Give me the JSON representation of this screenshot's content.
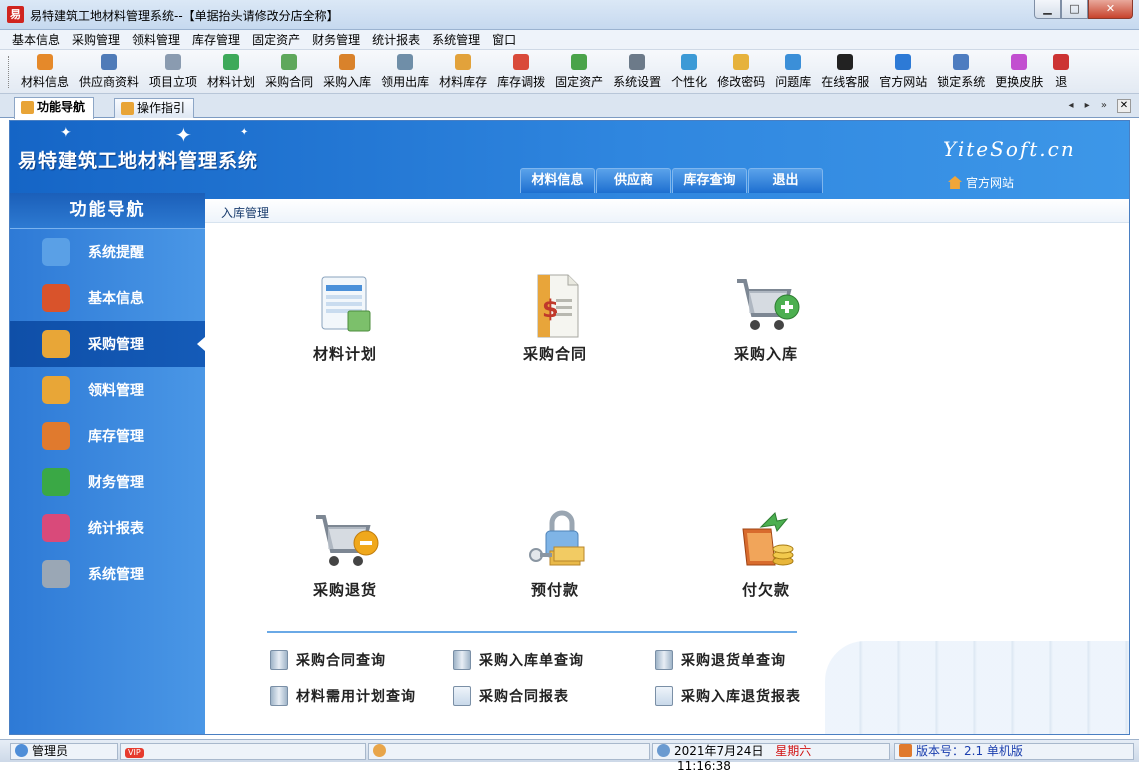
{
  "window": {
    "title": "易特建筑工地材料管理系统--【单据抬头请修改分店全称】",
    "app_icon_text": "易",
    "buttons": {
      "minimize": "▁",
      "maximize": "□",
      "close": "✕"
    }
  },
  "menu": [
    "基本信息",
    "采购管理",
    "领料管理",
    "库存管理",
    "固定资产",
    "财务管理",
    "统计报表",
    "系统管理",
    "窗口"
  ],
  "toolbar": [
    {
      "label": "材料信息",
      "icon": "materials-icon",
      "color": "#e5892a"
    },
    {
      "label": "供应商资料",
      "icon": "supplier-icon",
      "color": "#4f7bb8"
    },
    {
      "label": "项目立项",
      "icon": "project-icon",
      "color": "#8a9bb0"
    },
    {
      "label": "材料计划",
      "icon": "plan-icon",
      "color": "#3da95a"
    },
    {
      "label": "采购合同",
      "icon": "contract-icon",
      "color": "#5fa85c"
    },
    {
      "label": "采购入库",
      "icon": "truck-icon",
      "color": "#d9822b"
    },
    {
      "label": "领用出库",
      "icon": "cart-icon",
      "color": "#6f8ea8"
    },
    {
      "label": "材料库存",
      "icon": "stock-icon",
      "color": "#e2a23b"
    },
    {
      "label": "库存调拨",
      "icon": "transfer-icon",
      "color": "#d94a3a"
    },
    {
      "label": "固定资产",
      "icon": "asset-icon",
      "color": "#4aa34a"
    },
    {
      "label": "系统设置",
      "icon": "settings-icon",
      "color": "#6c7a89"
    },
    {
      "label": "个性化",
      "icon": "personalize-icon",
      "color": "#3c9ad6"
    },
    {
      "label": "修改密码",
      "icon": "key-icon",
      "color": "#e6b23c"
    },
    {
      "label": "问题库",
      "icon": "question-icon",
      "color": "#3b8fd8"
    },
    {
      "label": "在线客服",
      "icon": "qq-icon",
      "color": "#222222"
    },
    {
      "label": "官方网站",
      "icon": "ie-icon",
      "color": "#2d7ad6"
    },
    {
      "label": "锁定系统",
      "icon": "lock-icon",
      "color": "#4d7cc0"
    },
    {
      "label": "更换皮肤",
      "icon": "skin-icon",
      "color": "#c24fd0"
    },
    {
      "label": "退",
      "icon": "exit-icon",
      "color": "#cc3333"
    }
  ],
  "tabs": [
    {
      "label": "功能导航",
      "active": true
    },
    {
      "label": "操作指引",
      "active": false
    }
  ],
  "tab_nav": "◂ ▸ »",
  "tab_close": "✕",
  "banner": {
    "title": "易特建筑工地材料管理系统",
    "brand": "YiteSoft.cn",
    "official_site": "官方网站",
    "nav": [
      "材料信息",
      "供应商",
      "库存查询",
      "退出"
    ]
  },
  "sidebar": {
    "header": "功能导航",
    "items": [
      {
        "label": "系统提醒",
        "icon": "info-icon",
        "color": "#5aa0e6",
        "active": false
      },
      {
        "label": "基本信息",
        "icon": "cubes-icon",
        "color": "#d9532b",
        "active": false
      },
      {
        "label": "采购管理",
        "icon": "purchase-box-icon",
        "color": "#e8a637",
        "active": true
      },
      {
        "label": "领料管理",
        "icon": "requisition-box-icon",
        "color": "#e8a637",
        "active": false
      },
      {
        "label": "库存管理",
        "icon": "warehouse-icon",
        "color": "#e07a2e",
        "active": false
      },
      {
        "label": "财务管理",
        "icon": "bar-chart-icon",
        "color": "#3aa845",
        "active": false
      },
      {
        "label": "统计报表",
        "icon": "report-icon",
        "color": "#d94a7a",
        "active": false
      },
      {
        "label": "系统管理",
        "icon": "tools-icon",
        "color": "#9aa7b5",
        "active": false
      }
    ]
  },
  "content": {
    "breadcrumb": "入库管理",
    "tiles": [
      {
        "label": "材料计划",
        "icon": "material-plan-icon"
      },
      {
        "label": "采购合同",
        "icon": "purchase-contract-icon"
      },
      {
        "label": "采购入库",
        "icon": "cart-add-icon"
      },
      {
        "label": "采购退货",
        "icon": "cart-remove-icon"
      },
      {
        "label": "预付款",
        "icon": "prepayment-icon"
      },
      {
        "label": "付欠款",
        "icon": "pay-debt-icon"
      }
    ],
    "links": [
      {
        "label": "采购合同查询",
        "icon": "book-icon"
      },
      {
        "label": "采购入库单查询",
        "icon": "book-icon"
      },
      {
        "label": "采购退货单查询",
        "icon": "book-icon"
      },
      {
        "label": "材料需用计划查询",
        "icon": "book-icon"
      },
      {
        "label": "采购合同报表",
        "icon": "report-search-icon"
      },
      {
        "label": "采购入库退货报表",
        "icon": "report-search-icon"
      }
    ]
  },
  "status": {
    "user": "管理员",
    "vip": "VIP",
    "date": "2021年7月24日",
    "weekday": "星期六",
    "time": "11:16:38",
    "version": "版本号：2.1 单机版"
  }
}
